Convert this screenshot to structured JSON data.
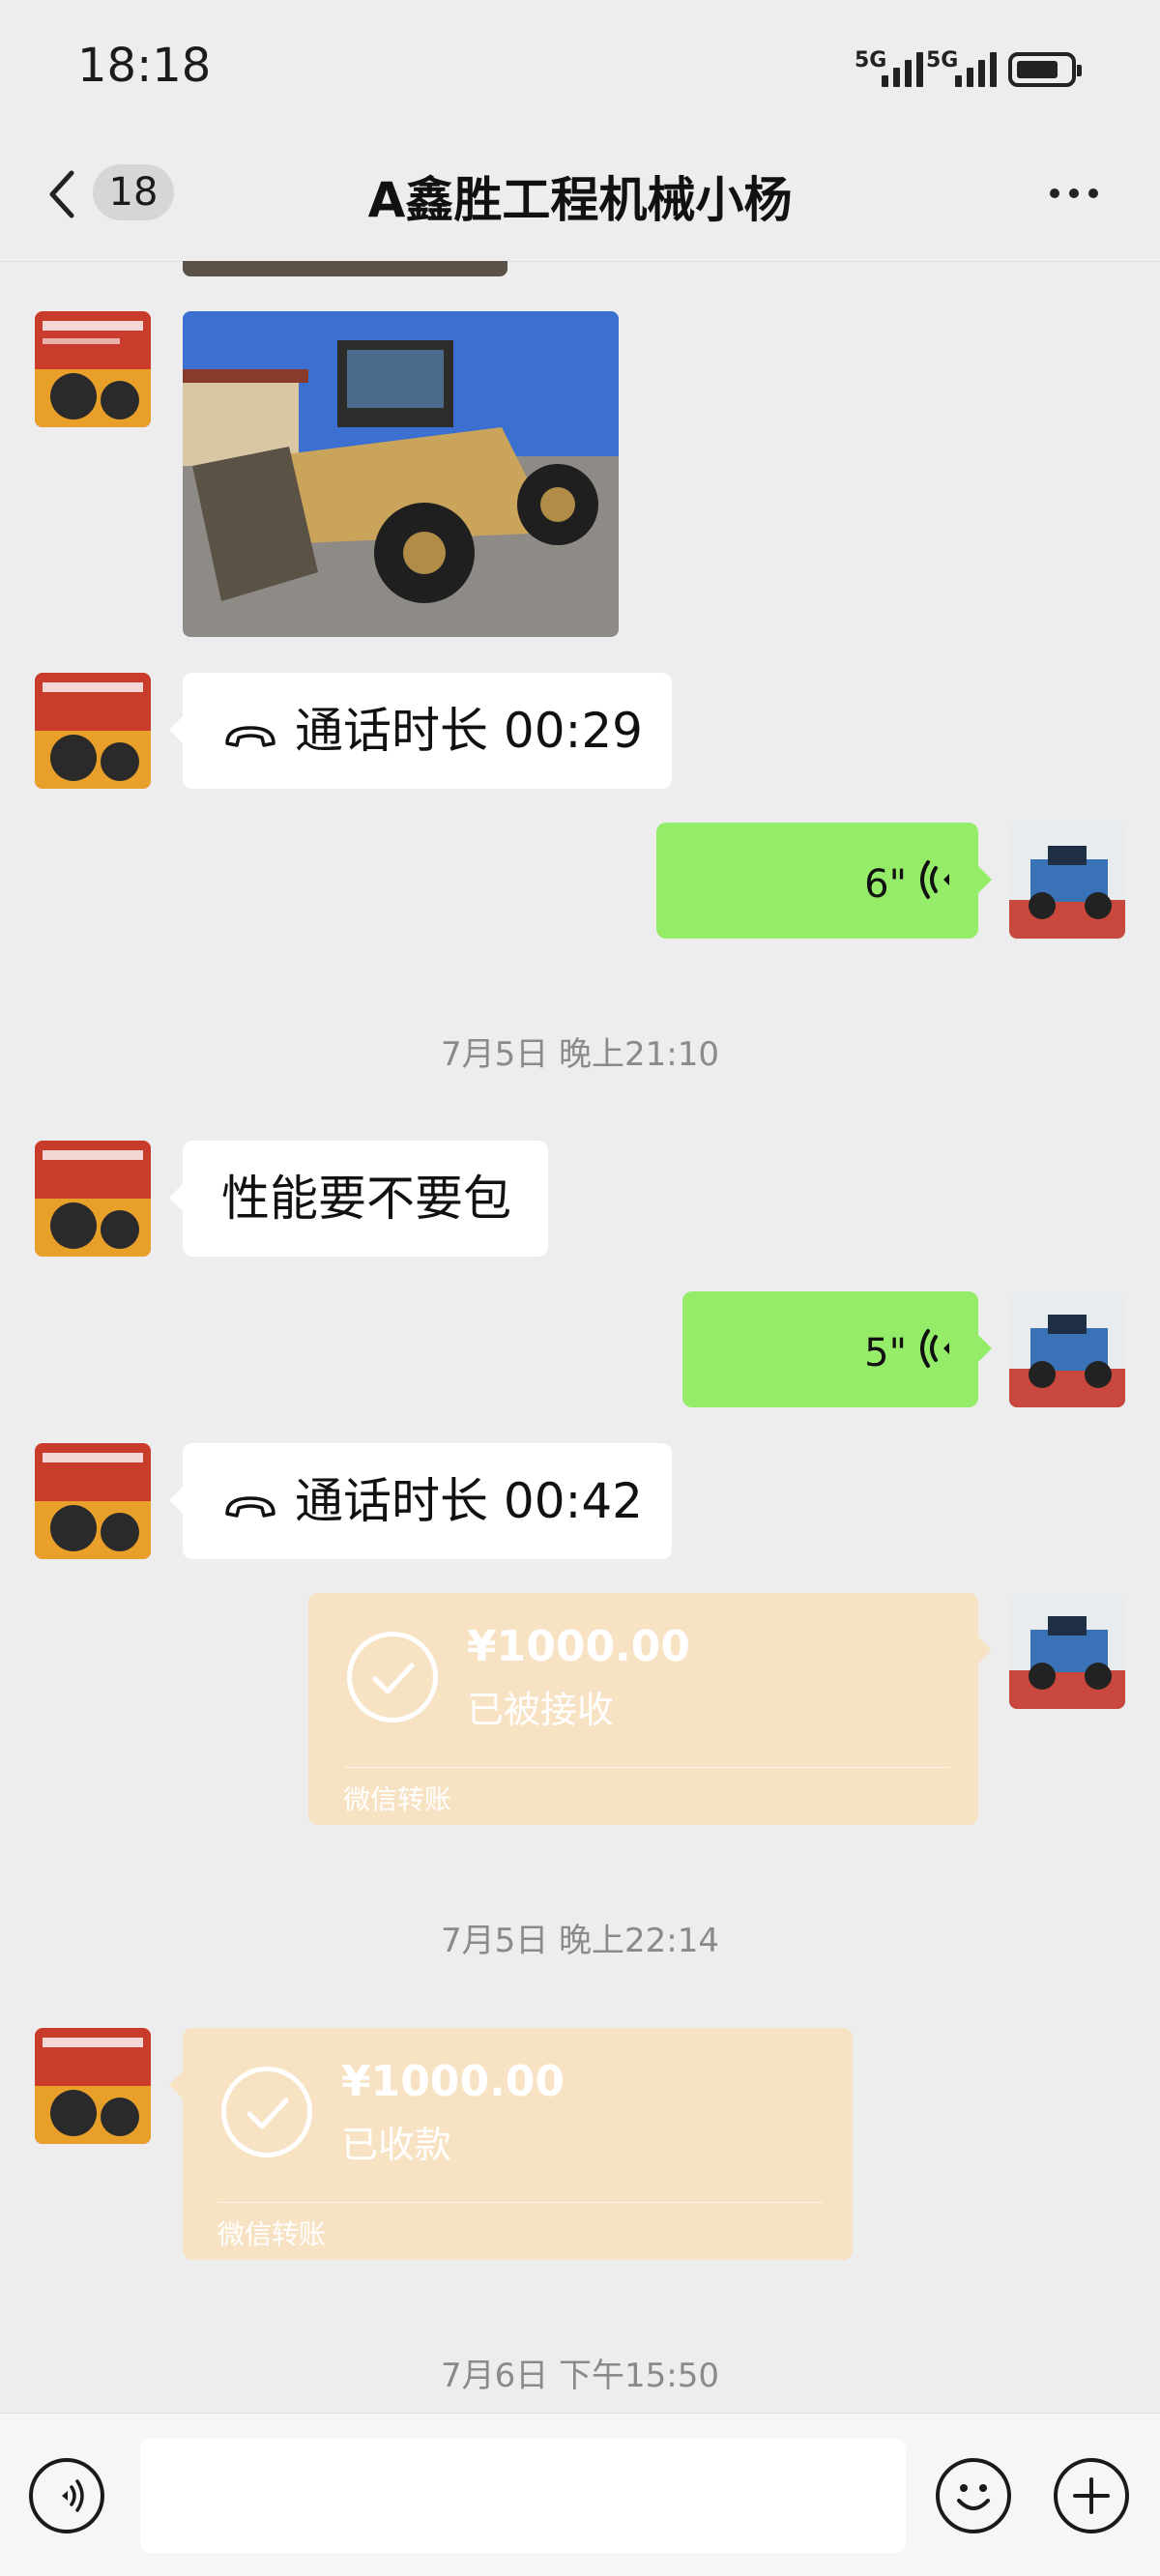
{
  "status_bar": {
    "time": "18:18",
    "signal1": "5G",
    "signal2": "5G"
  },
  "header": {
    "unread_count": "18",
    "title": "A鑫胜工程机械小杨"
  },
  "messages": {
    "call1": {
      "label": "通话时长 00:29"
    },
    "voice1": {
      "duration": "6\""
    },
    "timestamp1": "7月5日 晚上21:10",
    "text1": "性能要不要包",
    "voice2": {
      "duration": "5\""
    },
    "call2": {
      "label": "通话时长 00:42"
    },
    "transfer1": {
      "amount": "¥1000.00",
      "status": "已被接收",
      "label": "微信转账"
    },
    "timestamp2": "7月5日 晚上22:14",
    "transfer2": {
      "amount": "¥1000.00",
      "status": "已收款",
      "label": "微信转账"
    },
    "timestamp3": "7月6日 下午15:50"
  },
  "colors": {
    "sent_bubble": "#95ec69",
    "received_bubble": "#ffffff",
    "transfer_card": "#f8e2c4",
    "background": "#ededed"
  },
  "icons": [
    "back-chevron-icon",
    "more-icon",
    "phone-icon",
    "voice-wave-icon",
    "check-circle-icon",
    "voice-input-icon",
    "emoji-icon",
    "plus-icon"
  ]
}
